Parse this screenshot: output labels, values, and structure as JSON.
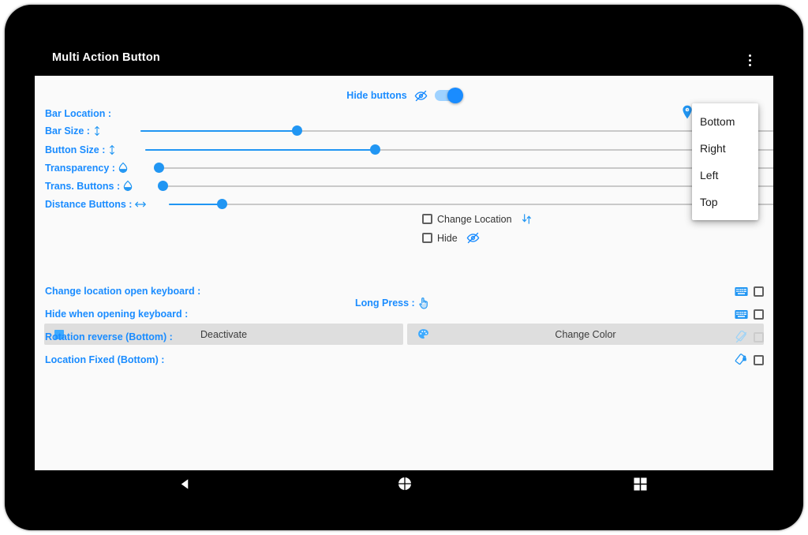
{
  "app": {
    "title": "Multi Action Button",
    "overflow_icon": "more-vert-icon",
    "accent_color": "#2196f3",
    "label_color": "#1a8cff",
    "appbar_bg": "#000000",
    "content_bg": "#fafafa",
    "button_bg": "#dedede"
  },
  "hide_buttons": {
    "label": "Hide buttons",
    "icon": "eye-off-icon",
    "toggle_state": "on"
  },
  "sliders": [
    {
      "label": "Bar Location :",
      "icon": null,
      "has_slider": false,
      "value_pct": 0
    },
    {
      "label": "Bar Size :",
      "icon": "height-icon",
      "has_slider": true,
      "value_pct": 24
    },
    {
      "label": "Button Size :",
      "icon": "height-icon",
      "has_slider": true,
      "value_pct": 36
    },
    {
      "label": "Transparency :",
      "icon": "opacity-icon",
      "has_slider": true,
      "value_pct": 1
    },
    {
      "label": "Trans. Buttons :",
      "icon": "opacity-icon",
      "has_slider": true,
      "value_pct": 1
    },
    {
      "label": "Distance Buttons :",
      "icon": "arrows-horizontal-icon",
      "has_slider": true,
      "value_pct": 10
    }
  ],
  "bar_location": {
    "pin_icon": "location-pin-icon",
    "selected": "Bottom",
    "caret_icon": "chevron-down-icon",
    "options": [
      "Bottom",
      "Right",
      "Left",
      "Top"
    ],
    "open": true
  },
  "long_press": {
    "label": "Long Press :",
    "icon": "touch-hand-icon",
    "items": [
      {
        "label": "Change Location",
        "checked": false,
        "icon": "arrows-vertical-icon"
      },
      {
        "label": "Hide",
        "checked": false,
        "icon": "eye-off-icon"
      }
    ]
  },
  "action_buttons": [
    {
      "label": "Deactivate",
      "icon": "stop-square-icon"
    },
    {
      "label": "Change Color",
      "icon": "palette-icon"
    }
  ],
  "options": [
    {
      "label": "Change location open keyboard :",
      "icon": "keyboard-icon",
      "icon_enabled": true,
      "checked": false,
      "checkbox_enabled": true
    },
    {
      "label": "Hide when opening keyboard :",
      "icon": "keyboard-icon",
      "icon_enabled": true,
      "checked": false,
      "checkbox_enabled": true
    },
    {
      "label": "Rotation reverse (Bottom) :",
      "icon": "screen-rotation-off-icon",
      "icon_enabled": false,
      "checked": false,
      "checkbox_enabled": false
    },
    {
      "label": "Location Fixed (Bottom) :",
      "icon": "screen-lock-rotation-icon",
      "icon_enabled": true,
      "checked": false,
      "checkbox_enabled": true
    }
  ],
  "nav_bar": {
    "back": "back-triangle-icon",
    "home": "home-circle-icon",
    "recents": "recents-square-icon"
  }
}
